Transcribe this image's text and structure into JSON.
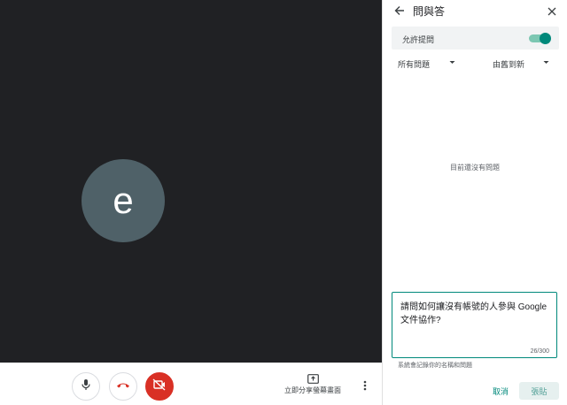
{
  "stage": {
    "avatar_letter": "e"
  },
  "controls": {
    "mic_icon": "mic-icon",
    "hangup_icon": "call-end-icon",
    "camera_icon": "videocam-off-icon",
    "present_label": "立即分享螢幕畫面",
    "more_icon": "more-vertical-icon"
  },
  "panel": {
    "title": "問與答",
    "allow_label": "允許提問",
    "allow_enabled": true,
    "filter_label": "所有問題",
    "sort_label": "由舊到新",
    "empty_text": "目前還沒有問題",
    "question_value": "請問如何讓沒有帳號的人參與 Google 文件協作?",
    "char_count": "26/300",
    "hint": "系統會記錄你的名稱和問題",
    "cancel_label": "取消",
    "post_label": "張貼"
  },
  "colors": {
    "accent": "#00897b",
    "hangup": "#d93025",
    "stage_bg": "#202124",
    "avatar_bg": "#4f6168"
  }
}
